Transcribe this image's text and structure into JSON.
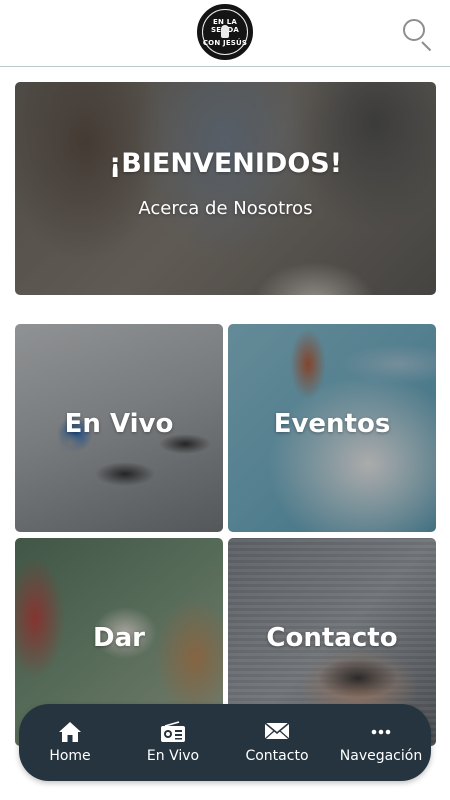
{
  "header": {
    "logo_text_top": "EN LA SENDA",
    "logo_text_bottom": "CON JESÚS",
    "search_icon": "search-icon"
  },
  "hero": {
    "title": "¡BIENVENIDOS!",
    "subtitle": "Acerca de Nosotros"
  },
  "tiles": [
    {
      "label": "En Vivo"
    },
    {
      "label": "Eventos"
    },
    {
      "label": "Dar"
    },
    {
      "label": "Contacto"
    }
  ],
  "nav": {
    "items": [
      {
        "label": "Home",
        "icon": "home-icon"
      },
      {
        "label": "En Vivo",
        "icon": "radio-icon"
      },
      {
        "label": "Contacto",
        "icon": "mail-icon"
      },
      {
        "label": "Navegación",
        "icon": "more-icon"
      }
    ]
  },
  "colors": {
    "navbar_bg": "#26343f",
    "header_border": "#b9c8cf",
    "text_on_image": "#ffffff"
  }
}
